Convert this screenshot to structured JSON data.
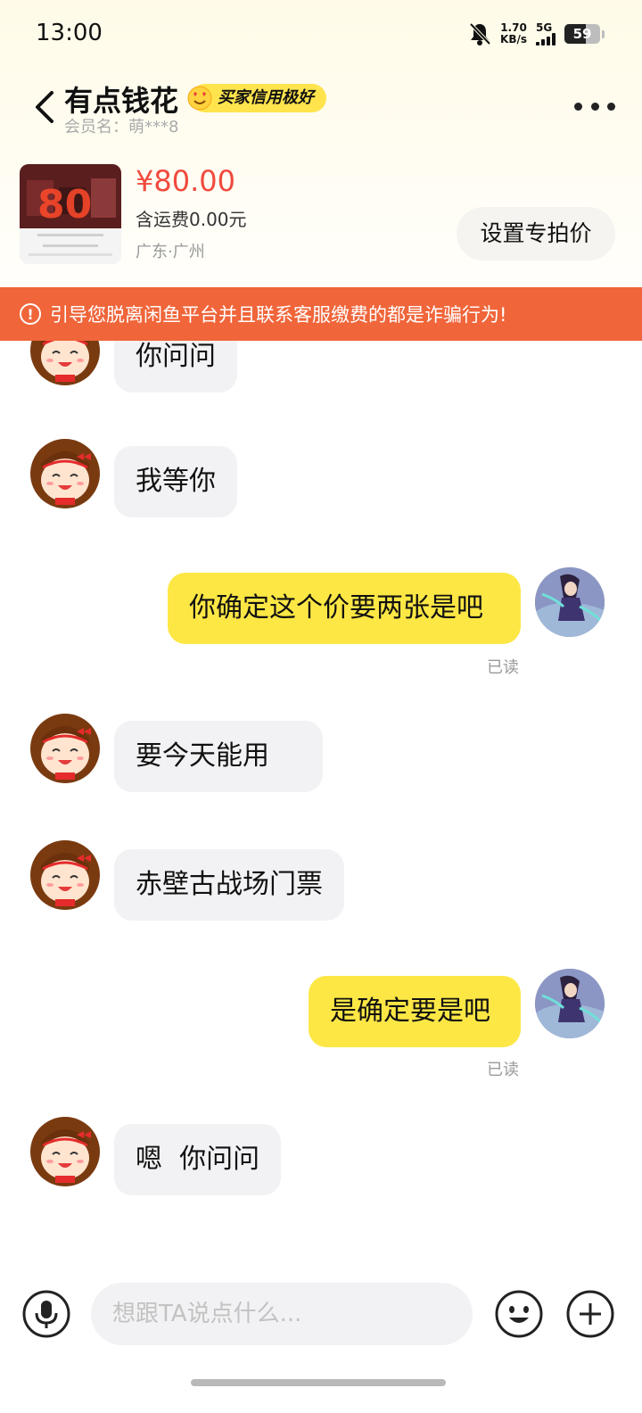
{
  "status_bar": {
    "time": "13:00",
    "speed_value": "1.70",
    "speed_unit": "KB/s",
    "network": "5G",
    "battery": "59",
    "battery_level": 0.59,
    "icons": [
      "bell-muted-icon",
      "signal-icon",
      "battery-icon"
    ]
  },
  "header": {
    "title": "有点钱花",
    "badge": "买家信用极好",
    "subtitle": "会员名：萌***8",
    "back_icon": "chevron-left-icon",
    "more_icon": "more-dots-icon"
  },
  "product": {
    "price": "¥80.00",
    "shipping": "含运费0.00元",
    "location": "广东·广州",
    "special_price_button": "设置专拍价"
  },
  "warning": {
    "icon": "!",
    "text": "引导您脱离闲鱼平台并且联系客服缴费的都是诈骗行为!"
  },
  "messages": [
    {
      "side": "left",
      "text": "你问问"
    },
    {
      "side": "left",
      "text": "我等你"
    },
    {
      "side": "right",
      "text": "你确定这个价要两张是吧",
      "status": "已读"
    },
    {
      "side": "left",
      "text": "要今天能用"
    },
    {
      "side": "left",
      "text": "赤壁古战场门票"
    },
    {
      "side": "right",
      "text": "是确定要是吧",
      "status": "已读"
    },
    {
      "side": "left",
      "text": "嗯  你问问"
    }
  ],
  "input_bar": {
    "placeholder": "想跟TA说点什么...",
    "icons": [
      "microphone-icon",
      "emoji-icon",
      "plus-icon"
    ]
  },
  "colors": {
    "accent_yellow": "#fde745",
    "warning_orange": "#f0653a",
    "price_red": "#f04a3e"
  }
}
